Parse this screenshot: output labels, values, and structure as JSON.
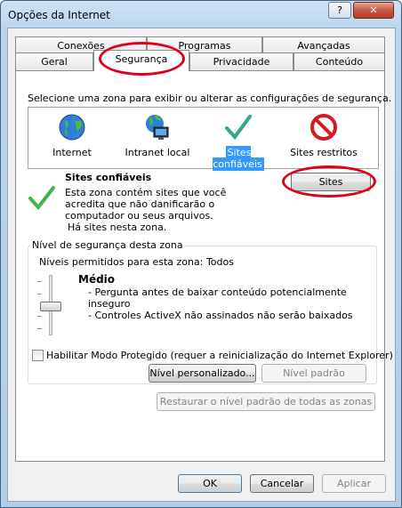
{
  "window": {
    "title": "Opções da Internet",
    "help_glyph": "?",
    "close_glyph": "✕"
  },
  "tabs": {
    "row1": [
      "Conexões",
      "Programas",
      "Avançadas"
    ],
    "row2": [
      "Geral",
      "Segurança",
      "Privacidade",
      "Conteúdo"
    ],
    "active": "Segurança"
  },
  "security": {
    "zone_prompt": "Selecione uma zona para exibir ou alterar as configurações de segurança.",
    "zones": [
      {
        "label": "Internet",
        "icon": "globe-icon"
      },
      {
        "label": "Intranet local",
        "icon": "intranet-icon"
      },
      {
        "label": "Sites confiáveis",
        "icon": "checkmark-icon",
        "selected": true
      },
      {
        "label": "Sites restritos",
        "icon": "restricted-icon"
      }
    ],
    "zone_title": "Sites confiáveis",
    "zone_desc_lines": [
      "Esta zona contém sites que você",
      "acredita que não danificarão o",
      "computador ou seus arquivos.",
      "Há sites nesta zona."
    ],
    "sites_button": "Sites",
    "level_group_label": "Nível de segurança desta zona",
    "allowed_levels": "Níveis permitidos para esta zona: Todos",
    "level_name": "Médio",
    "level_bullets": [
      "- Pergunta antes de baixar conteúdo potencialmente",
      "inseguro",
      "- Controles ActiveX não assinados não serão baixados"
    ],
    "protected_mode_label": "Habilitar Modo Protegido (requer a reinicialização do Internet Explorer)",
    "protected_mode_checked": false,
    "custom_level_button": "Nível personalizado...",
    "default_level_button": "Nível padrão",
    "restore_all_button": "Restaurar o nível padrão de todas as zonas"
  },
  "footer": {
    "ok": "OK",
    "cancel": "Cancelar",
    "apply": "Aplicar"
  },
  "colors": {
    "selection": "#3399ff",
    "annotation": "#e0001b"
  }
}
